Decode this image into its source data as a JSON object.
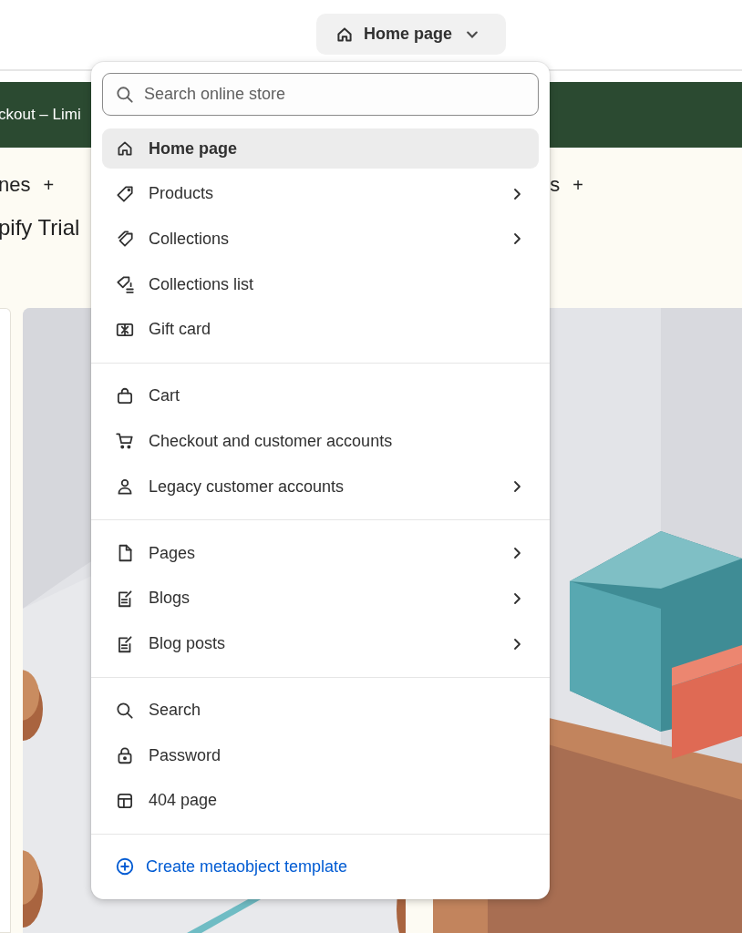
{
  "page_selector": {
    "label": "Home page"
  },
  "preview": {
    "banner_text": "ckout – Limi",
    "nav_left": {
      "text": "nes",
      "plus": "+"
    },
    "nav_right": {
      "text": "s",
      "plus": "+"
    },
    "title_fragment": "pify Trial"
  },
  "menu": {
    "search": {
      "placeholder": "Search online store"
    },
    "groups": [
      {
        "items": [
          {
            "label": "Home page",
            "selected": true,
            "submenu": false
          },
          {
            "label": "Products",
            "selected": false,
            "submenu": true
          },
          {
            "label": "Collections",
            "selected": false,
            "submenu": true
          },
          {
            "label": "Collections list",
            "selected": false,
            "submenu": false
          },
          {
            "label": "Gift card",
            "selected": false,
            "submenu": false
          }
        ]
      },
      {
        "items": [
          {
            "label": "Cart",
            "selected": false,
            "submenu": false
          },
          {
            "label": "Checkout and customer accounts",
            "selected": false,
            "submenu": false
          },
          {
            "label": "Legacy customer accounts",
            "selected": false,
            "submenu": true
          }
        ]
      },
      {
        "items": [
          {
            "label": "Pages",
            "selected": false,
            "submenu": true
          },
          {
            "label": "Blogs",
            "selected": false,
            "submenu": true
          },
          {
            "label": "Blog posts",
            "selected": false,
            "submenu": true
          }
        ]
      },
      {
        "items": [
          {
            "label": "Search",
            "selected": false,
            "submenu": false
          },
          {
            "label": "Password",
            "selected": false,
            "submenu": false
          },
          {
            "label": "404 page",
            "selected": false,
            "submenu": false
          }
        ]
      }
    ],
    "create_link": "Create metaobject template"
  }
}
